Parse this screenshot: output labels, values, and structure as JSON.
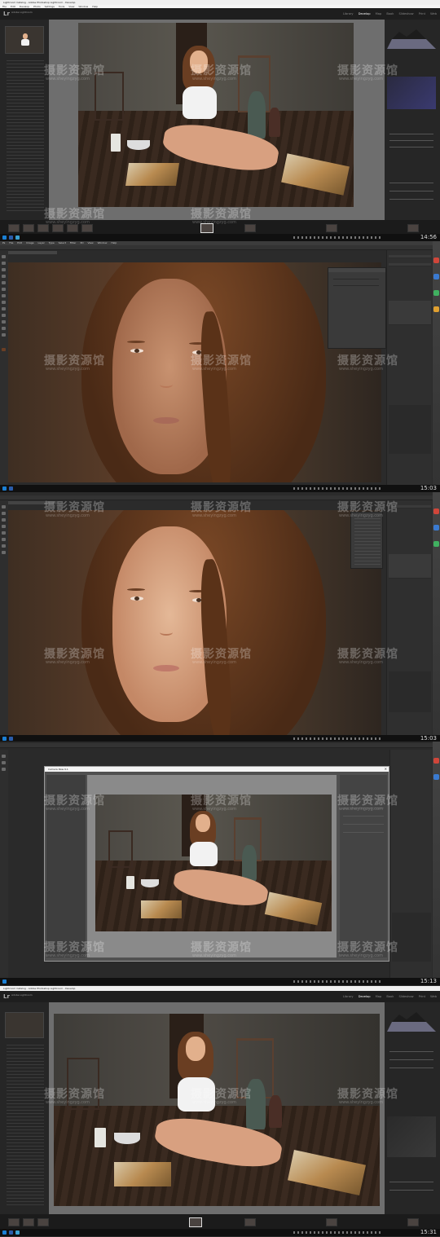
{
  "frame1": {
    "title": "Lightroom Catalog - Adobe Photoshop Lightroom - Develop",
    "menu": [
      "File",
      "Edit",
      "Develop",
      "Photo",
      "Settings",
      "Tools",
      "View",
      "Window",
      "Help"
    ],
    "identity": "Adobe Lightroom",
    "modules": [
      "Library",
      "Develop",
      "Map",
      "Book",
      "Slideshow",
      "Print",
      "Web"
    ],
    "active_module": "Develop",
    "clock": "14:56"
  },
  "frame2": {
    "menu": [
      "Ps",
      "File",
      "Edit",
      "Image",
      "Layer",
      "Type",
      "Select",
      "Filter",
      "3D",
      "View",
      "Window",
      "Help"
    ],
    "clock": "15:03"
  },
  "frame3": {
    "clock": "15:03"
  },
  "frame4": {
    "dialog_title": "Camera Raw 9.1",
    "clock": "15:13"
  },
  "frame5": {
    "title": "Lightroom Catalog - Adobe Photoshop Lightroom - Develop",
    "identity": "Adobe Lightroom",
    "modules": [
      "Library",
      "Develop",
      "Map",
      "Book",
      "Slideshow",
      "Print",
      "Web"
    ],
    "active_module": "Develop",
    "clock": "15:31"
  },
  "watermark": {
    "text": "摄影资源馆",
    "sub": "www.sheyingzyg.com"
  },
  "colors": {
    "accent": "#00a0e0",
    "panel": "#262626",
    "dark": "#1b1b1b"
  }
}
